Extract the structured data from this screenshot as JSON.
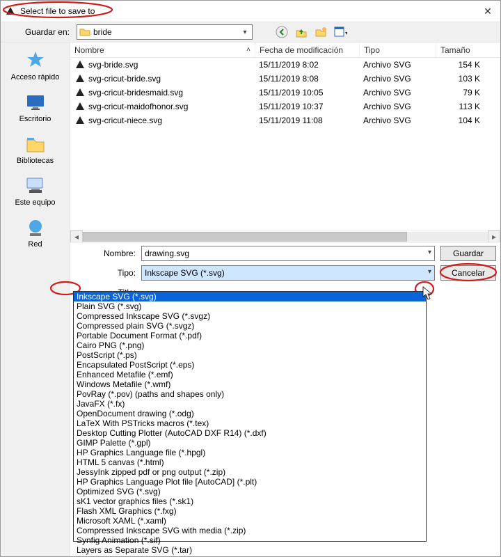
{
  "window": {
    "title": "Select file to save to",
    "close_tooltip": "Close"
  },
  "toolbar": {
    "save_in_label": "Guardar en:",
    "current_folder": "bride"
  },
  "places": [
    {
      "label": "Acceso rápido",
      "icon": "star"
    },
    {
      "label": "Escritorio",
      "icon": "desktop"
    },
    {
      "label": "Bibliotecas",
      "icon": "libraries"
    },
    {
      "label": "Este equipo",
      "icon": "pc"
    },
    {
      "label": "Red",
      "icon": "network"
    }
  ],
  "columns": {
    "name": "Nombre",
    "date": "Fecha de modificación",
    "type": "Tipo",
    "size": "Tamaño"
  },
  "files": [
    {
      "name": "svg-bride.svg",
      "date": "15/11/2019 8:02",
      "type": "Archivo SVG",
      "size": "154 K"
    },
    {
      "name": "svg-cricut-bride.svg",
      "date": "15/11/2019 8:08",
      "type": "Archivo SVG",
      "size": "103 K"
    },
    {
      "name": "svg-cricut-bridesmaid.svg",
      "date": "15/11/2019 10:05",
      "type": "Archivo SVG",
      "size": "79 K"
    },
    {
      "name": "svg-cricut-maidofhonor.svg",
      "date": "15/11/2019 10:37",
      "type": "Archivo SVG",
      "size": "113 K"
    },
    {
      "name": "svg-cricut-niece.svg",
      "date": "15/11/2019 11:08",
      "type": "Archivo SVG",
      "size": "104 K"
    }
  ],
  "form": {
    "name_label": "Nombre:",
    "name_value": "drawing.svg",
    "type_label": "Tipo:",
    "type_value": "Inkscape SVG (*.svg)",
    "title_label": "Title:",
    "title_value": "",
    "save_button": "Guardar",
    "cancel_button": "Cancelar"
  },
  "type_options": [
    "Inkscape SVG (*.svg)",
    "Plain SVG (*.svg)",
    "Compressed Inkscape SVG (*.svgz)",
    "Compressed plain SVG (*.svgz)",
    "Portable Document Format (*.pdf)",
    "Cairo PNG (*.png)",
    "PostScript (*.ps)",
    "Encapsulated PostScript (*.eps)",
    "Enhanced Metafile (*.emf)",
    "Windows Metafile (*.wmf)",
    "PovRay (*.pov) (paths and shapes only)",
    "JavaFX (*.fx)",
    "OpenDocument drawing (*.odg)",
    "LaTeX With PSTricks macros (*.tex)",
    "Desktop Cutting Plotter (AutoCAD DXF R14) (*.dxf)",
    "GIMP Palette (*.gpl)",
    "HP Graphics Language file (*.hpgl)",
    "HTML 5 canvas (*.html)",
    "JessyInk zipped pdf or png output (*.zip)",
    "HP Graphics Language Plot file [AutoCAD] (*.plt)",
    "Optimized SVG (*.svg)",
    "sK1 vector graphics files (*.sk1)",
    "Flash XML Graphics (*.fxg)",
    "Microsoft XAML (*.xaml)",
    "Compressed Inkscape SVG with media (*.zip)",
    "Synfig Animation (*.sif)",
    "Layers as Separate SVG (*.tar)"
  ],
  "annotations": {
    "title_circle": true,
    "type_label_circle": true,
    "type_dropdown_caret_circle": true,
    "save_button_circle": true,
    "plt_option_circle": true
  }
}
